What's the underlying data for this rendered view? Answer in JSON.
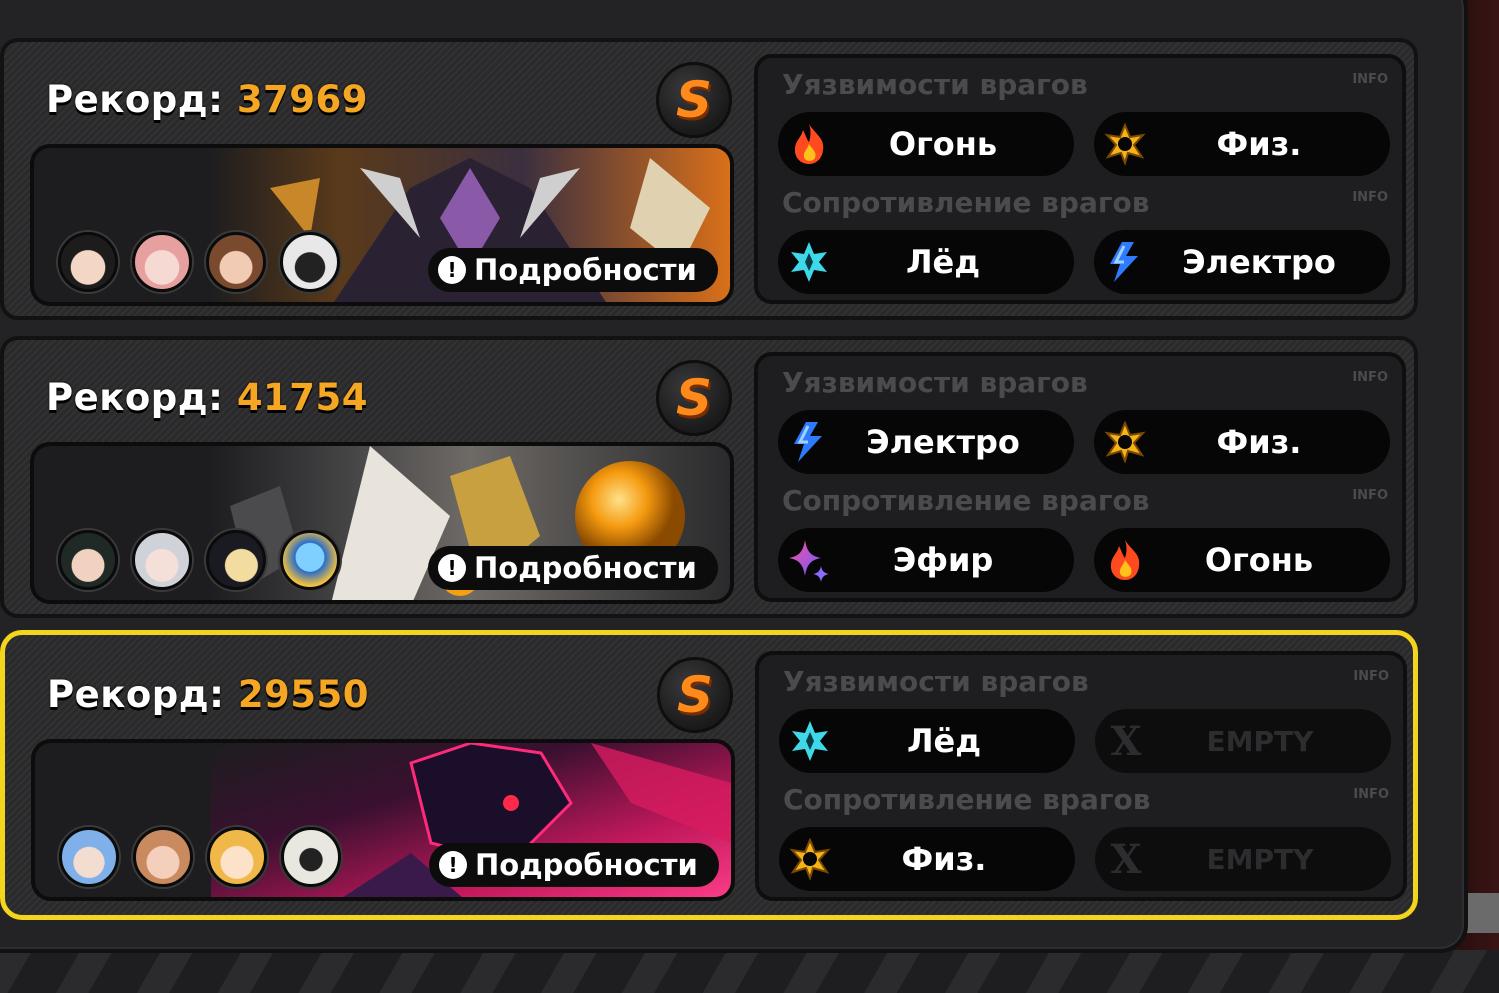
{
  "colors": {
    "record_value": "#f5a623",
    "rank_letter": "#ff8a1c",
    "selected_border": "#f2d51c"
  },
  "labels": {
    "record_prefix": "Рекорд:",
    "details_button": "Подробности",
    "weakness_title": "Уязвимости врагов",
    "resistance_title": "Сопротивление врагов",
    "info": "INFO"
  },
  "rows": [
    {
      "record": "37969",
      "rank": "S",
      "selected": false,
      "weaknesses": [
        {
          "label": "Огонь",
          "icon": "fire-icon"
        },
        {
          "label": "Физ.",
          "icon": "physical-icon"
        }
      ],
      "resistances": [
        {
          "label": "Лёд",
          "icon": "ice-icon"
        },
        {
          "label": "Электро",
          "icon": "electric-icon"
        }
      ]
    },
    {
      "record": "41754",
      "rank": "S",
      "selected": false,
      "weaknesses": [
        {
          "label": "Электро",
          "icon": "electric-icon"
        },
        {
          "label": "Физ.",
          "icon": "physical-icon"
        }
      ],
      "resistances": [
        {
          "label": "Эфир",
          "icon": "ether-icon"
        },
        {
          "label": "Огонь",
          "icon": "fire-icon"
        }
      ]
    },
    {
      "record": "29550",
      "rank": "S",
      "selected": true,
      "weaknesses": [
        {
          "label": "Лёд",
          "icon": "ice-icon"
        },
        {
          "label": "EMPTY",
          "icon": "empty-x-icon"
        }
      ],
      "resistances": [
        {
          "label": "Физ.",
          "icon": "physical-icon"
        },
        {
          "label": "EMPTY",
          "icon": "empty-x-icon"
        }
      ]
    }
  ]
}
